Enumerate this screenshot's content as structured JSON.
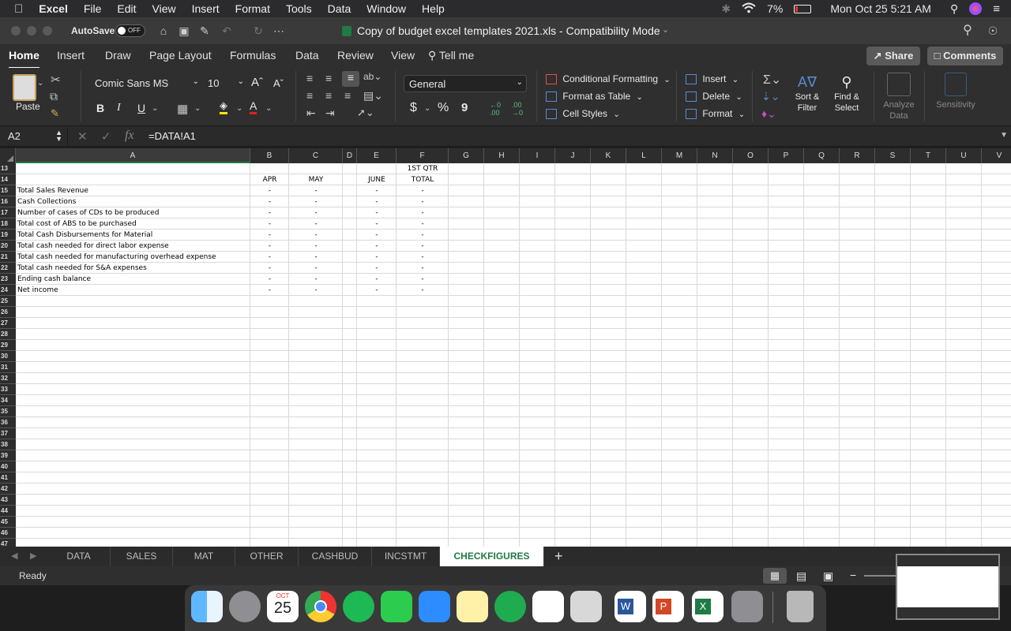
{
  "menubar": {
    "app": "Excel",
    "items": [
      "File",
      "Edit",
      "View",
      "Insert",
      "Format",
      "Tools",
      "Data",
      "Window",
      "Help"
    ],
    "battery": "7%",
    "clock": "Mon Oct 25  5:21 AM"
  },
  "titlebar": {
    "autosave_label": "AutoSave",
    "autosave_state": "OFF",
    "document_title": "Copy of budget excel templates 2021.xls  -  Compatibility Mode"
  },
  "ribbon_tabs": [
    "Home",
    "Insert",
    "Draw",
    "Page Layout",
    "Formulas",
    "Data",
    "Review",
    "View"
  ],
  "tell_me": "Tell me",
  "share_label": "Share",
  "comments_label": "Comments",
  "ribbon": {
    "paste": "Paste",
    "font_name": "Comic Sans MS",
    "font_size": "10",
    "bold": "B",
    "italic": "I",
    "underline": "U",
    "number_format": "General",
    "currency": "$",
    "percent": "%",
    "comma": "9",
    "conditional_formatting": "Conditional Formatting",
    "format_as_table": "Format as Table",
    "cell_styles": "Cell Styles",
    "insert": "Insert",
    "delete": "Delete",
    "format": "Format",
    "sort_filter_1": "Sort &",
    "sort_filter_2": "Filter",
    "find_select_1": "Find &",
    "find_select_2": "Select",
    "analyze_1": "Analyze",
    "analyze_2": "Data",
    "sensitivity": "Sensitivity"
  },
  "formula_bar": {
    "name_box": "A2",
    "fx": "fx",
    "formula": "=DATA!A1"
  },
  "columns": [
    "A",
    "B",
    "C",
    "D",
    "E",
    "F",
    "G",
    "H",
    "I",
    "J",
    "K",
    "L",
    "M",
    "N",
    "O",
    "P",
    "Q",
    "R",
    "S",
    "T",
    "U",
    "V"
  ],
  "rows": [
    "13",
    "14",
    "15",
    "16",
    "17",
    "18",
    "19",
    "20",
    "21",
    "22",
    "23",
    "24",
    "25",
    "26",
    "27",
    "28",
    "29",
    "30",
    "31",
    "32",
    "33",
    "34",
    "35",
    "36",
    "37",
    "38",
    "39",
    "40",
    "41",
    "42",
    "43",
    "44",
    "45",
    "46",
    "47"
  ],
  "sheet": {
    "f13": "1ST QTR",
    "headers": {
      "b": "APR",
      "c": "MAY",
      "e": "JUNE",
      "f": "TOTAL"
    },
    "line_items": [
      "Total Sales Revenue",
      "Cash Collections",
      "Number of cases of CDs to be produced",
      "Total cost of ABS to be purchased",
      "Total Cash Disbursements for Material",
      "Total cash needed for direct labor expense",
      "Total cash needed for manufacturing overhead expense",
      "Total cash needed for S&A expenses",
      "Ending cash balance",
      "Net income"
    ],
    "dash": "-"
  },
  "sheet_tabs": [
    "DATA",
    "SALES",
    "MAT",
    "OTHER",
    "CASHBUD",
    "INCSTMT",
    "CHECKFIGURES"
  ],
  "add_sheet": "+",
  "status": "Ready",
  "dock": {
    "calendar_month": "OCT",
    "calendar_day": "25"
  }
}
